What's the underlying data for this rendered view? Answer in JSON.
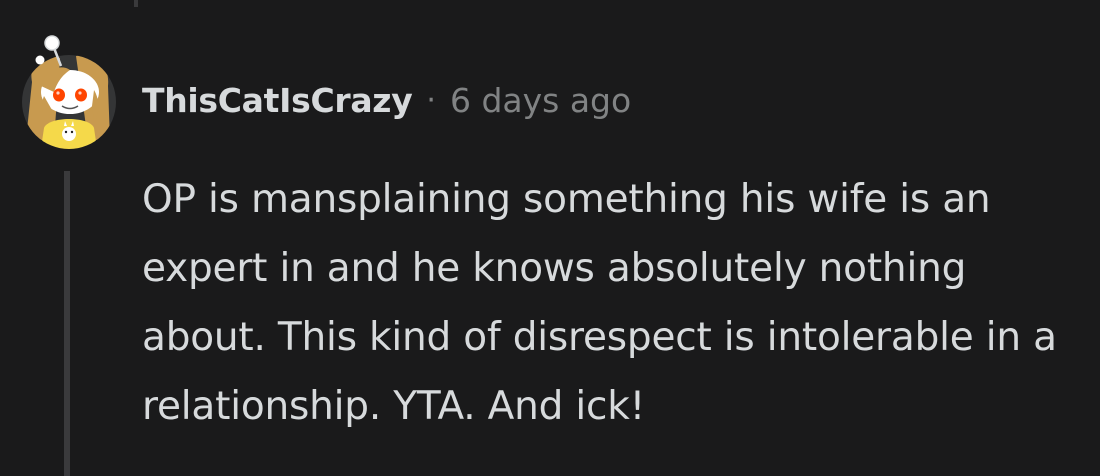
{
  "comment": {
    "author": "ThisCatIsCrazy",
    "separator": "·",
    "timestamp": "6 days ago",
    "avatar_icon": "reddit-snoovatar-icon",
    "body": "OP is mansplaining something his wife is an expert in and he knows absolutely nothing about. This kind of disrespect is intolerable in a relationship. YTA. And ick!"
  },
  "colors": {
    "background": "#1a1a1b",
    "text_primary": "#d7dadc",
    "text_secondary": "#818384",
    "thread_line": "#3a3a3c",
    "avatar_bg": "#343536",
    "avatar_hair": "#c89a4f",
    "avatar_eyes": "#ff4500",
    "avatar_shirt": "#f5d94a"
  }
}
